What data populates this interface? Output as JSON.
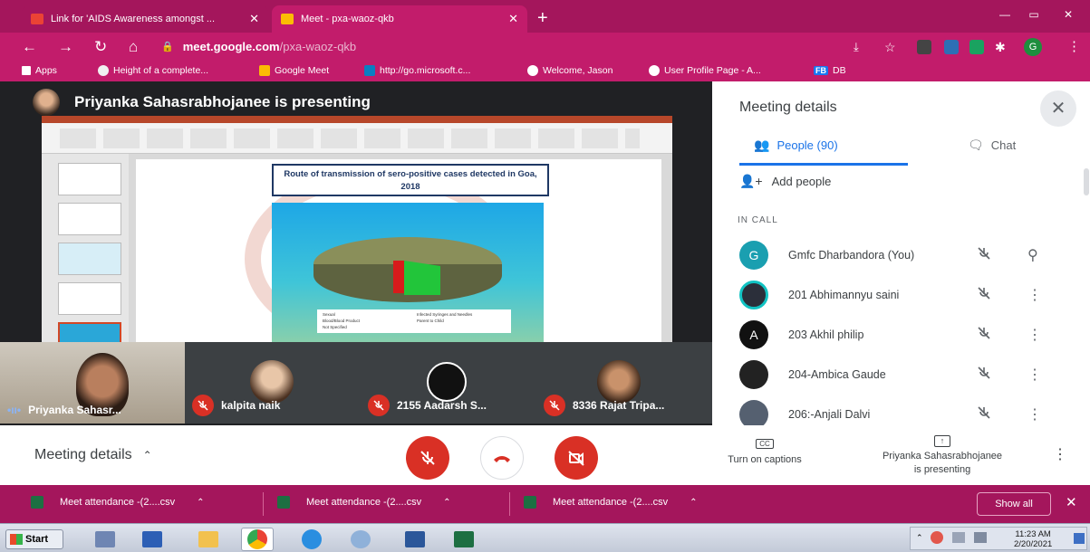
{
  "browser": {
    "tabs": [
      {
        "label": "Link for 'AIDS Awareness amongst ...",
        "close": "✕"
      },
      {
        "label": "Meet - pxa-waoz-qkb",
        "close": "✕"
      }
    ],
    "new_tab": "+",
    "window_controls": [
      "—",
      "▭",
      "✕"
    ],
    "url_host": "meet.google.com",
    "url_path": "/pxa-waoz-qkb",
    "profile_initial": "G",
    "bookmarks": [
      "Apps",
      "Height of a complete...",
      "Google Meet",
      "http://go.microsoft.c...",
      "Welcome, Jason",
      "User Profile Page - A...",
      "DB"
    ],
    "bookmark_db_badge": "FB"
  },
  "presentation": {
    "banner": "Priyanka Sahasrabhojanee is presenting",
    "slide_title": "Route of transmission of sero-positive cases detected in Goa, 2018",
    "chart_legend": [
      "Sexual",
      "Parent to Child",
      "Blood/Blood Product",
      "Infected Syringes and Needles",
      "Not Specified"
    ]
  },
  "tiles": [
    {
      "name": "Priyanka Sahasr...",
      "muted": false
    },
    {
      "name": "kalpita naik",
      "muted": true
    },
    {
      "name": "2155 Aadarsh S...",
      "muted": true
    },
    {
      "name": "8336 Rajat Tripa...",
      "muted": true
    }
  ],
  "panel": {
    "title": "Meeting details",
    "close": "✕",
    "tab_people": "People (90)",
    "tab_chat": "Chat",
    "add_people": "Add people",
    "in_call": "IN CALL",
    "participants": [
      {
        "name": "Gmfc Dharbandora (You)",
        "initial": "G",
        "color": "#1a9fb0",
        "action": "pin"
      },
      {
        "name": "201 Abhimannyu saini",
        "initial": "",
        "color": "#2b2f3a",
        "action": "more"
      },
      {
        "name": "203 Akhil philip",
        "initial": "A",
        "color": "#111111",
        "action": "more"
      },
      {
        "name": "204-Ambica Gaude",
        "initial": "",
        "color": "#222222",
        "action": "more"
      },
      {
        "name": "206:-Anjali Dalvi",
        "initial": "",
        "color": "#556070",
        "action": "more"
      }
    ]
  },
  "bottom": {
    "meeting_details": "Meeting details",
    "captions": "Turn on captions",
    "captions_badge": "CC",
    "presenting_line1": "Priyanka Sahasrabhojanee",
    "presenting_line2": "is presenting"
  },
  "downloads": {
    "items": [
      "Meet attendance -(2....csv",
      "Meet attendance -(2....csv",
      "Meet attendance -(2....csv"
    ],
    "show_all": "Show all",
    "close": "✕"
  },
  "taskbar": {
    "start": "Start",
    "time": "11:23 AM",
    "date": "2/20/2021"
  },
  "colors": {
    "chrome": "#a4165c",
    "chrome_active": "#c21c6b",
    "meet_red": "#d93025",
    "link_blue": "#1a73e8"
  }
}
